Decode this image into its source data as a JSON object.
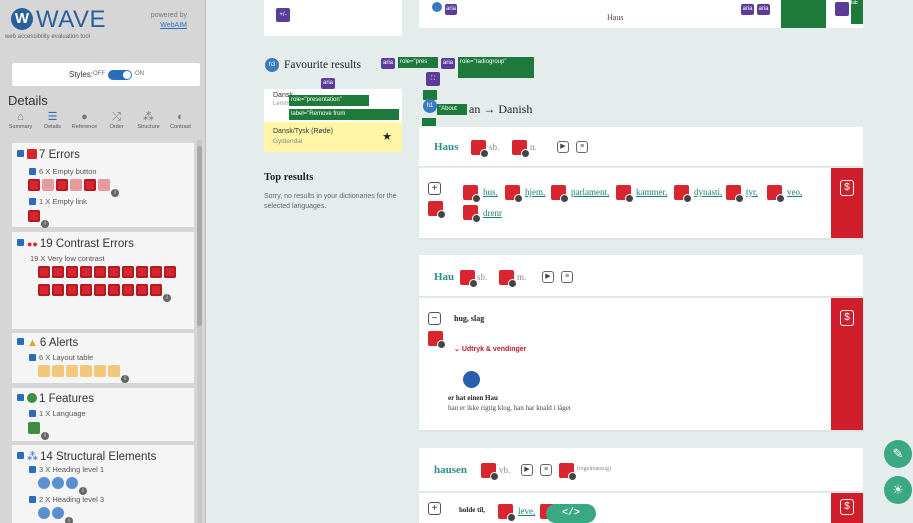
{
  "wave": {
    "logo_mark": "W",
    "logo_text": "WAVE",
    "tagline": "web accessibility evaluation tool",
    "powered_by": "powered by",
    "webaim": "WebAIM",
    "styles_label": "Styles:",
    "styles_off": "OFF",
    "styles_on": "ON",
    "details_title": "Details",
    "tabs": [
      {
        "label": "Summary",
        "icon": "home-icon",
        "glyph": "⌂"
      },
      {
        "label": "Details",
        "icon": "list-icon",
        "glyph": "☰"
      },
      {
        "label": "Reference",
        "icon": "info-icon",
        "glyph": "●"
      },
      {
        "label": "Order",
        "icon": "order-icon",
        "glyph": "⤮"
      },
      {
        "label": "Structure",
        "icon": "structure-icon",
        "glyph": "⁂"
      },
      {
        "label": "Contrast",
        "icon": "contrast-icon",
        "glyph": "◐"
      }
    ],
    "sections": {
      "errors": {
        "title": "7 Errors",
        "items": [
          {
            "label": "6 X Empty button"
          },
          {
            "label": "1 X Empty link"
          }
        ]
      },
      "contrast": {
        "title": "19 Contrast Errors",
        "items": [
          {
            "label": "19 X Very low contrast"
          }
        ]
      },
      "alerts": {
        "title": "6 Alerts",
        "items": [
          {
            "label": "6 X Layout table"
          }
        ]
      },
      "features": {
        "title": "1 Features",
        "items": [
          {
            "label": "1 X Language"
          }
        ]
      },
      "structural": {
        "title": "14 Structural Elements",
        "items": [
          {
            "label": "3 X Heading level 1"
          },
          {
            "label": "2 X Heading level 3"
          }
        ]
      }
    },
    "colors": {
      "error": "#d9262e",
      "alert": "#e0a020",
      "feature": "#3f8c44",
      "structure": "#2a6ebb"
    }
  },
  "page": {
    "top_word": "Haus",
    "favourites_title": "Favourite results",
    "fav_item_name": "Dansk/Tysk (Røde)",
    "fav_item_publisher": "Gyldendal",
    "fav_item_top_text": "Dansk",
    "fav_item_top_text2": "Lemmat",
    "top_results_title": "Top results",
    "top_results_text": "Sorry, no results in your dictionaries for the selected languages.",
    "lang_from": "an",
    "lang_arrow": "→",
    "lang_to": "Danish",
    "aria_chips": {
      "aria": "aria",
      "role_pres_short": "role=\"pres",
      "role_radiogroup": "role=\"radiogroup\"",
      "role_presentation": "role=\"presentation\"",
      "remove_from": "label=\"Remove from",
      "about": "\"About"
    },
    "entries": [
      {
        "headword": "Haus",
        "pos1": "sb.",
        "pos2": "n.",
        "translations": [
          "hus,",
          "hjem,",
          "parlament,",
          "kammer,",
          "dynasti,",
          "tyr,",
          "veo,",
          "drenr"
        ]
      },
      {
        "headword": "Hau",
        "pos1": "sb.",
        "pos2": "m.",
        "definition": "hug, slag",
        "idioms_label": "Udtryk & vendinger",
        "example_de": "er hat einen Hau",
        "example_da": "han er ikke rigtig klog, han har knald i låget"
      },
      {
        "headword": "hausen",
        "pos1": "vb.",
        "tag": "(regelmæssig)",
        "definition_start": "holde til,",
        "translation": "leve,"
      }
    ],
    "code_button": "</>"
  }
}
